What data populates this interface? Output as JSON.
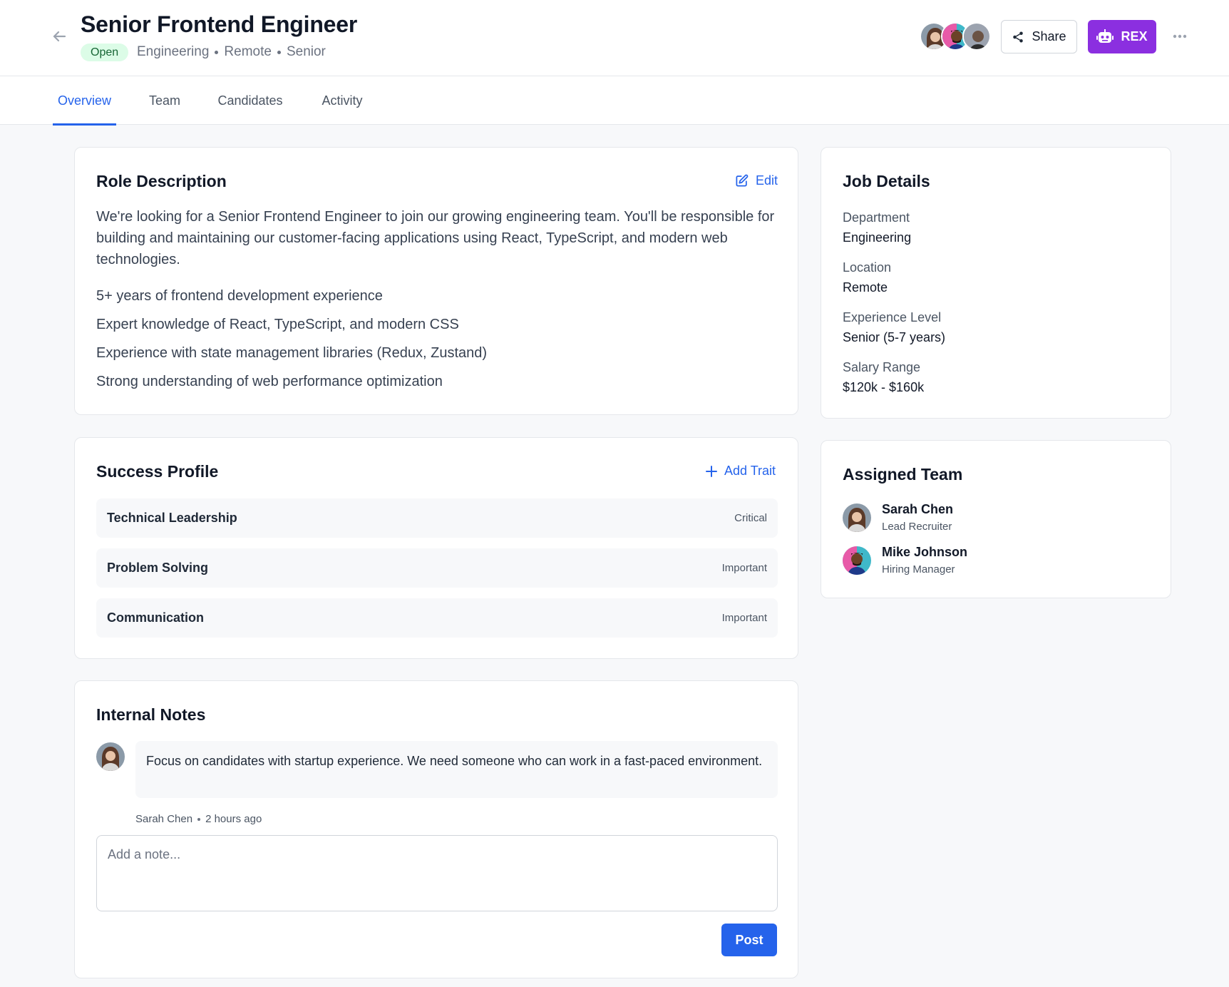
{
  "header": {
    "title": "Senior Frontend Engineer",
    "status": "Open",
    "meta": [
      "Engineering",
      "Remote",
      "Senior"
    ],
    "share_label": "Share",
    "rex_label": "REX",
    "colors": {
      "accent": "#2563eb",
      "rex": "#8b2fe0",
      "status_bg": "#dcfce7",
      "status_fg": "#166534"
    }
  },
  "tabs": [
    {
      "label": "Overview",
      "active": true
    },
    {
      "label": "Team"
    },
    {
      "label": "Candidates"
    },
    {
      "label": "Activity"
    }
  ],
  "role": {
    "title": "Role Description",
    "edit_label": "Edit",
    "description": "We're looking for a Senior Frontend Engineer to join our growing engineering team. You'll be responsible for building and maintaining our customer-facing applications using React, TypeScript, and modern web technologies.",
    "requirements": [
      "5+ years of frontend development experience",
      "Expert knowledge of React, TypeScript, and modern CSS",
      "Experience with state management libraries (Redux, Zustand)",
      "Strong understanding of web performance optimization"
    ]
  },
  "success": {
    "title": "Success Profile",
    "add_label": "Add Trait",
    "traits": [
      {
        "name": "Technical Leadership",
        "level": "Critical"
      },
      {
        "name": "Problem Solving",
        "level": "Important"
      },
      {
        "name": "Communication",
        "level": "Important"
      }
    ]
  },
  "notes": {
    "title": "Internal Notes",
    "items": [
      {
        "text": "Focus on candidates with startup experience. We need someone who can work in a fast-paced environment.",
        "author": "Sarah Chen",
        "time": "2 hours ago"
      }
    ],
    "placeholder": "Add a note...",
    "post_label": "Post"
  },
  "job_details": {
    "title": "Job Details",
    "fields": [
      {
        "label": "Department",
        "value": "Engineering"
      },
      {
        "label": "Location",
        "value": "Remote"
      },
      {
        "label": "Experience Level",
        "value": "Senior (5-7 years)"
      },
      {
        "label": "Salary Range",
        "value": "$120k - $160k"
      }
    ]
  },
  "team": {
    "title": "Assigned Team",
    "members": [
      {
        "name": "Sarah Chen",
        "role": "Lead Recruiter"
      },
      {
        "name": "Mike Johnson",
        "role": "Hiring Manager"
      }
    ]
  }
}
